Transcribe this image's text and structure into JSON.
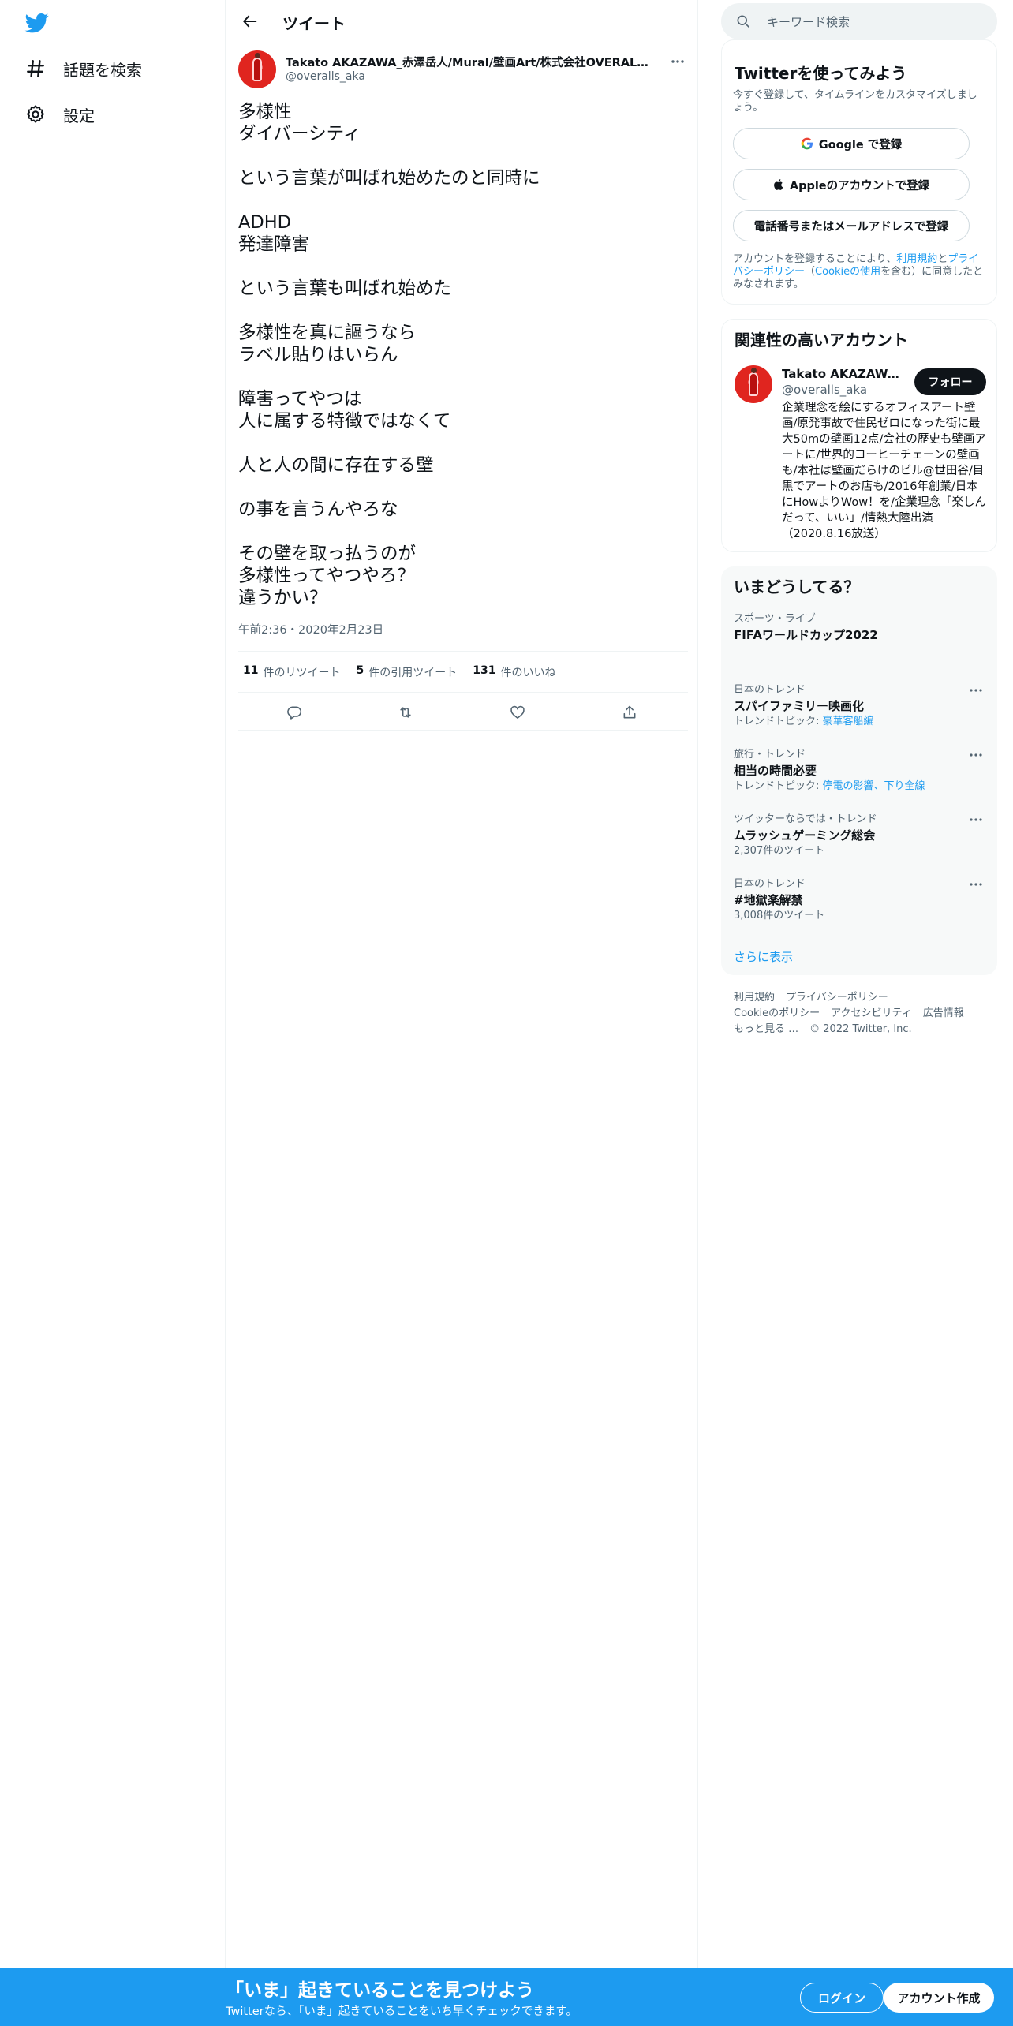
{
  "nav": {
    "logo": "twitter-bird-icon",
    "items": [
      {
        "label": "話題を検索",
        "icon": "hashtag-icon"
      },
      {
        "label": "設定",
        "icon": "gear-icon"
      }
    ]
  },
  "header": {
    "title": "ツイート"
  },
  "tweet": {
    "author_name": "Takato AKAZAWA_赤澤岳人/Mural/壁画Art/株式会社OVERALLs代表/...",
    "author_handle": "@overalls_aka",
    "lines": [
      "多様性",
      "ダイバーシティ",
      "",
      "という言葉が叫ばれ始めたのと同時に",
      "",
      "ADHD",
      "発達障害",
      "",
      "という言葉も叫ばれ始めた",
      "",
      "多様性を真に謳うなら",
      "ラベル貼りはいらん",
      "",
      "障害ってやつは",
      "人に属する特徴ではなくて",
      "",
      "人と人の間に存在する壁",
      "",
      "の事を言うんやろな",
      "",
      "その壁を取っ払うのが",
      "多様性ってやつやろ？",
      "違うかい？"
    ],
    "time": "午前2:36・2020年2月23日",
    "stats": {
      "retweets_count": "11",
      "retweets_label": "件のリツイート",
      "quotes_count": "5",
      "quotes_label": "件の引用ツイート",
      "likes_count": "131",
      "likes_label": "件のいいね"
    }
  },
  "search": {
    "placeholder": "キーワード検索"
  },
  "signup": {
    "title": "Twitterを使ってみよう",
    "subtitle": "今すぐ登録して、タイムラインをカスタマイズしましょう。",
    "google": "Google で登録",
    "apple": "Appleのアカウントで登録",
    "phone": "電話番号またはメールアドレスで登録",
    "legal_1": "アカウントを登録することにより、",
    "legal_terms": "利用規約",
    "legal_and": "と",
    "legal_privacy": "プライバシーポリシー",
    "legal_paren_open": "（",
    "legal_cookie": "Cookieの使用",
    "legal_2": "を含む）に同意したとみなされます。"
  },
  "related": {
    "title": "関連性の高いアカウント",
    "name": "Takato AKAZAWA_赤澤岳人/Mural/壁画Art",
    "handle": "@overalls_aka",
    "follow": "フォロー",
    "bio": "企業理念を絵にするオフィスアート壁画/原発事故で住民ゼロになった街に最大50mの壁画12点/会社の歴史も壁画アートに/世界的コーヒーチェーンの壁画も/本社は壁画だらけのビル@世田谷/目黒でアートのお店も/2016年創業/日本にHowよりWow！を/企業理念「楽しんだって、いい」/情熱大陸出演（2020.8.16放送）"
  },
  "trends": {
    "title": "いまどうしてる？",
    "items": [
      {
        "meta": "スポーツ・ライブ",
        "name": "FIFAワールドカップ2022",
        "sub_prefix": "",
        "sub_link": "",
        "has_more": false
      },
      {
        "meta": "日本のトレンド",
        "name": "スパイファミリー映画化",
        "sub_prefix": "トレンドトピック: ",
        "sub_link": "豪華客船編",
        "has_more": true
      },
      {
        "meta": "旅行・トレンド",
        "name": "相当の時間必要",
        "sub_prefix": "トレンドトピック: ",
        "sub_link": "停電の影響、下り全線",
        "has_more": true
      },
      {
        "meta": "ツイッターならでは・トレンド",
        "name": "ムラッシュゲーミング総会",
        "sub_prefix": "2,307件のツイート",
        "sub_link": "",
        "has_more": true
      },
      {
        "meta": "日本のトレンド",
        "name": "#地獄楽解禁",
        "sub_prefix": "3,008件のツイート",
        "sub_link": "",
        "has_more": true
      }
    ],
    "show_more": "さらに表示"
  },
  "footer": {
    "links": [
      "利用規約",
      "プライバシーポリシー",
      "Cookieのポリシー",
      "アクセシビリティ",
      "広告情報",
      "もっと見る …",
      "© 2022 Twitter, Inc."
    ]
  },
  "banner": {
    "title": "「いま」起きていることを見つけよう",
    "subtitle": "Twitterなら、「いま」起きていることをいち早くチェックできます。",
    "login": "ログイン",
    "signup": "アカウント作成"
  },
  "colors": {
    "accent": "#1d9bf0",
    "text": "#0f1419",
    "muted": "#536471",
    "border": "#eff3f4"
  }
}
